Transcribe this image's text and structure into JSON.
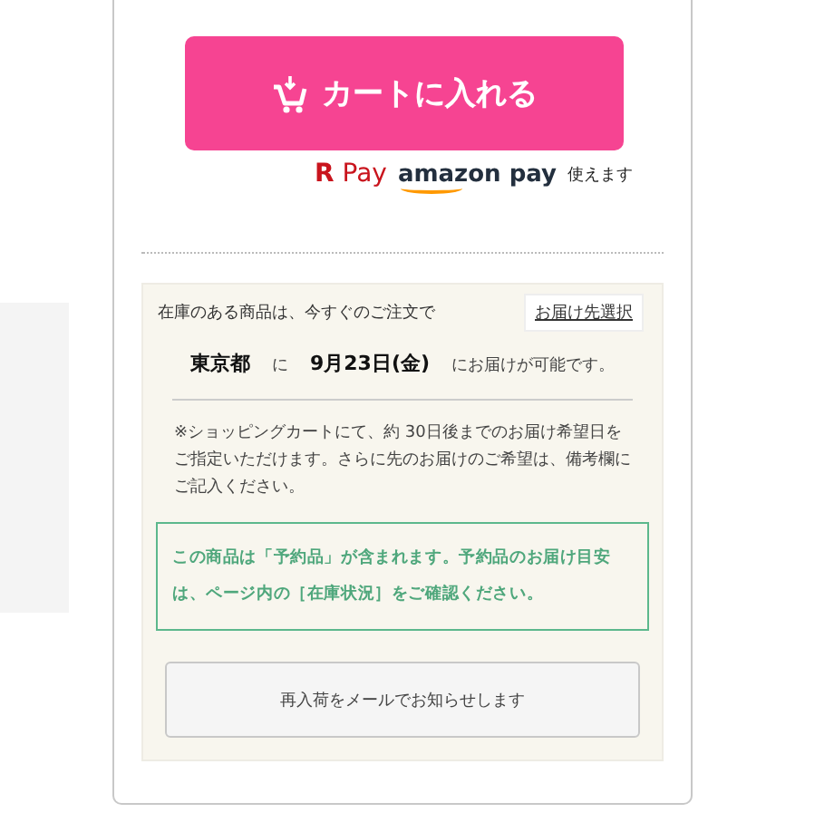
{
  "cart_button": {
    "label": "カートに入れる"
  },
  "payment": {
    "rakuten_pay": "**R** Pay",
    "amazon_pay": "amazon pay",
    "note": "使えます"
  },
  "delivery": {
    "intro": "在庫のある商品は、今すぐのご注文で",
    "address_button": "お届け先選択",
    "prefecture": "東京都",
    "particle": "に",
    "date": "9月23日(金)",
    "suffix": "にお届けが可能です。",
    "note": "※ショッピングカートにて、約 30日後までのお届け希望日をご指定いただけます。さらに先のお届けのご希望は、備考欄にご記入ください。"
  },
  "reservation_notice": "この商品は「予約品」が含まれます。予約品のお届け目安は、ページ内の［在庫状況］をご確認ください。",
  "restock_button": {
    "label": "再入荷をメールでお知らせします"
  }
}
